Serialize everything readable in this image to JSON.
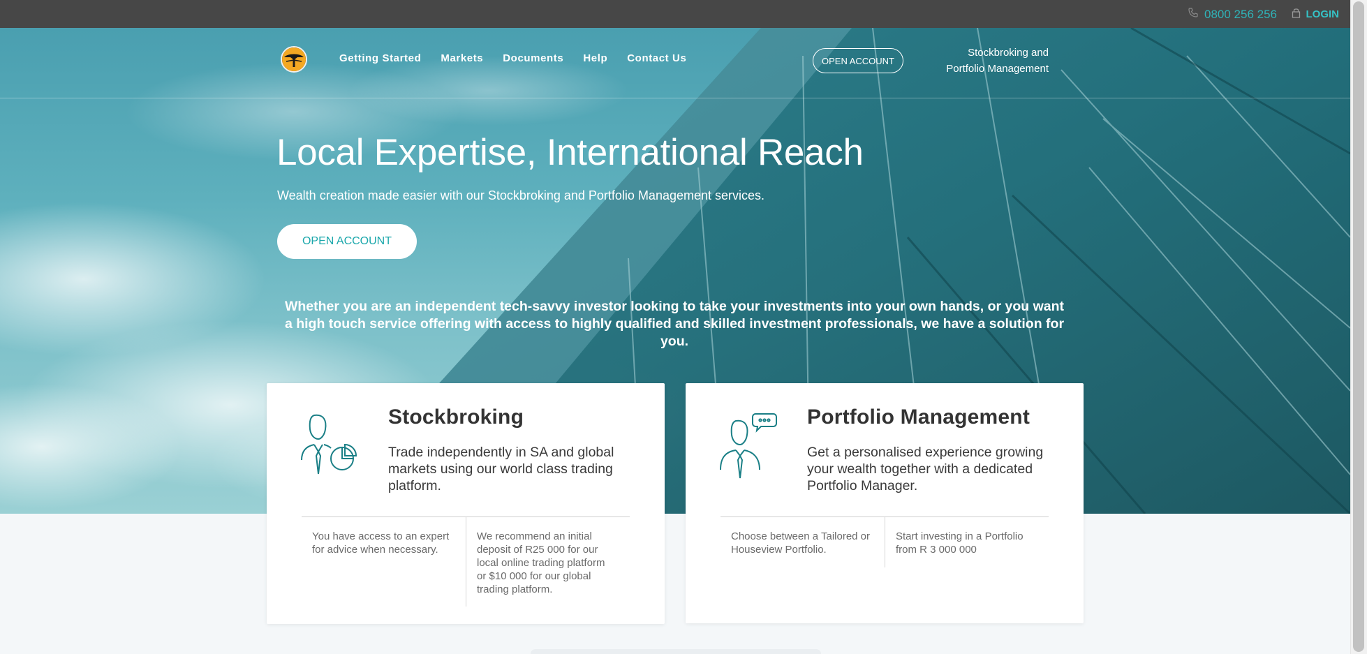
{
  "topbar": {
    "phone": "0800 256 256",
    "login": "LOGIN"
  },
  "nav": {
    "links": [
      "Getting Started",
      "Markets",
      "Documents",
      "Help",
      "Contact Us"
    ],
    "open_account": "OPEN ACCOUNT",
    "tagline_line1": "Stockbroking and",
    "tagline_line2": "Portfolio Management"
  },
  "hero": {
    "title": "Local Expertise, International Reach",
    "subtitle": "Wealth creation made easier with our Stockbroking and Portfolio Management services.",
    "button": "OPEN ACCOUNT",
    "lead": "Whether you are an independent tech-savvy investor looking to take your investments into your own hands, or you want a high touch service offering with access to highly qualified and skilled investment professionals, we have a solution for you."
  },
  "cards": [
    {
      "title": "Stockbroking",
      "description": "Trade independently in SA and global markets using our world class trading platform.",
      "features": [
        "You have access to an expert for advice when necessary.",
        "We recommend an initial deposit of R25 000 for our local online trading platform or $10 000 for our global trading platform."
      ],
      "icon": "investor-chart-icon"
    },
    {
      "title": "Portfolio Management",
      "description": "Get a personalised experience growing your wealth together with a dedicated Portfolio Manager.",
      "features": [
        "Choose between a Tailored or Houseview Portfolio.",
        "Start investing in a Portfolio from R 3 000 000"
      ],
      "icon": "advisor-chat-icon"
    }
  ],
  "colors": {
    "accent": "#1aa7ab",
    "topbar": "#474747",
    "icon_stroke": "#1a7f86"
  }
}
